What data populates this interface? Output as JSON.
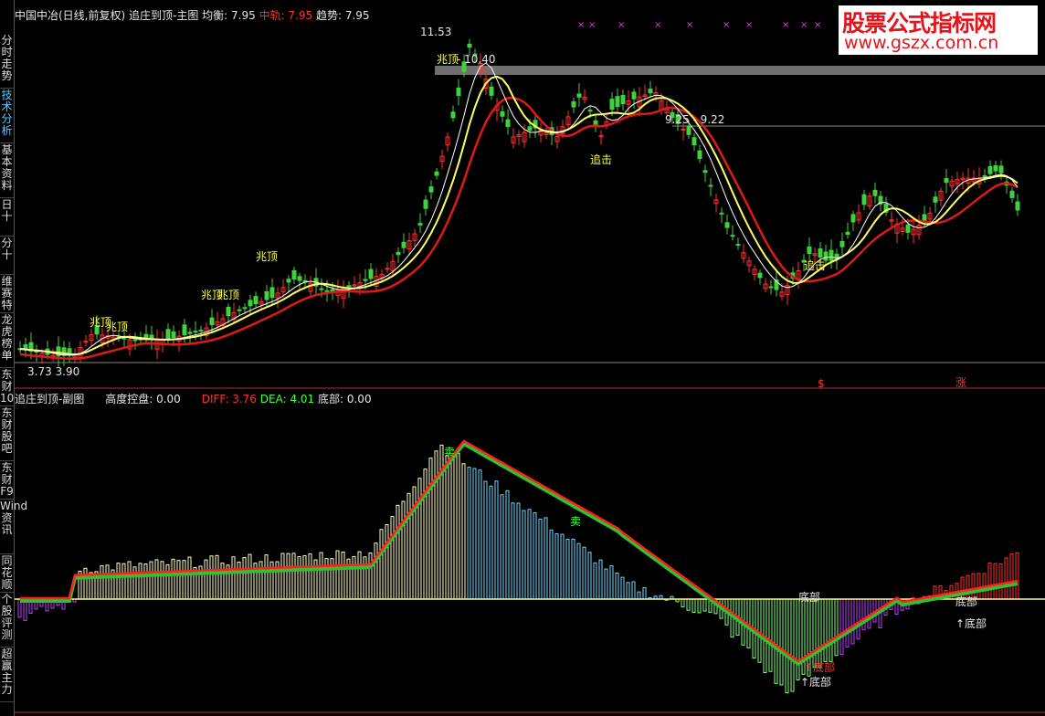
{
  "sidebar": {
    "items": [
      {
        "label": "分时走势",
        "active": false
      },
      {
        "label": "技术分析",
        "active": true
      },
      {
        "label": "基本资料",
        "active": false
      },
      {
        "label": "日十",
        "active": false
      },
      {
        "label": "分十",
        "active": false
      },
      {
        "label": "维赛特",
        "active": false
      },
      {
        "label": "龙虎榜单",
        "active": false
      },
      {
        "label": "东财10",
        "active": false
      },
      {
        "label": "东财股吧",
        "active": false
      },
      {
        "label": "东财F9",
        "active": false
      },
      {
        "label": "Wind资讯",
        "active": false
      },
      {
        "label": "同花顺",
        "active": false
      },
      {
        "label": "个股评测",
        "active": false
      },
      {
        "label": "超赢主力",
        "active": false
      }
    ]
  },
  "top_header": {
    "title": "中国中冶(日线,前复权) 追庄到顶-主图",
    "avg_label": "均衡: 7.95",
    "mid_label": "中轨: 7.95",
    "trend_label": "趋势: 7.95"
  },
  "sub_header": {
    "title": "追庄到顶-副图",
    "height_label": "高度控盘: 0.00",
    "diff_label": "DIFF: 3.76",
    "dea_label": "DEA: 4.01",
    "bottom_label": "底部: 0.00"
  },
  "watermark": {
    "title": "股票公式指标网",
    "url": "www.gszx.com.cn"
  },
  "annotations": {
    "high_price": "11.53",
    "range_upper": "- 10.40",
    "range_mid": "9.25 - 9.22",
    "low_range": "3.73  3.90",
    "top_signal": "兆顶",
    "chase": "追击",
    "sell": "卖",
    "bottom": "底部",
    "bottom_arrow": "↑底部",
    "rise": "涨",
    "dollar": "$"
  },
  "colors": {
    "up": "#ff3030",
    "down": "#40d040",
    "red_line": "#dd1a1a",
    "yellow_line": "#ffff60",
    "white_line": "#ffffff",
    "hist_pale": "#ffffc0",
    "hist_blue": "#70d8ff",
    "hist_green": "#80ff80",
    "hist_purple": "#c040ff",
    "hist_red": "#ff3030"
  },
  "chart_data": [
    {
      "type": "line",
      "title": "中国中冶(日线,前复权) 追庄到顶-主图",
      "series_note": "candlestick with moving averages",
      "price_labels": {
        "high": 11.53,
        "low": 3.73
      },
      "series": [
        {
          "name": "均衡",
          "last": 7.95
        },
        {
          "name": "中轨",
          "last": 7.95
        },
        {
          "name": "趋势",
          "last": 7.95
        }
      ]
    },
    {
      "type": "bar",
      "title": "追庄到顶-副图",
      "series": [
        {
          "name": "DIFF",
          "last": 3.76
        },
        {
          "name": "DEA",
          "last": 4.01
        },
        {
          "name": "高度控盘",
          "last": 0.0
        },
        {
          "name": "底部",
          "last": 0.0
        }
      ]
    }
  ]
}
